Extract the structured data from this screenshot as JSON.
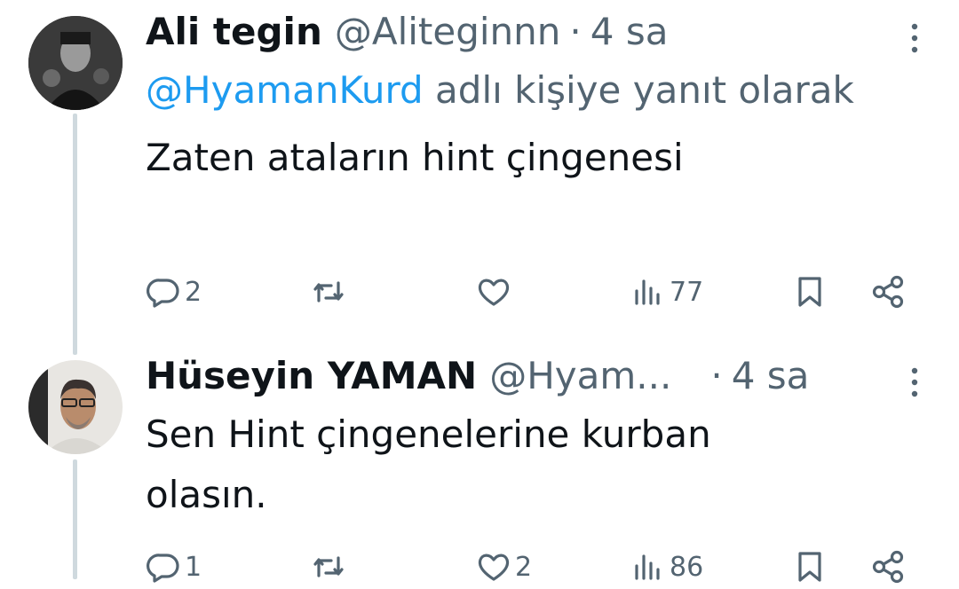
{
  "tweets": [
    {
      "display_name": "Ali tegin",
      "handle": "@Aliteginnn",
      "separator": "·",
      "time": "4 sa",
      "reply_mention": "@HyamanKurd",
      "reply_suffix": " adlı kişiye yanıt olarak",
      "text": "Zaten ataların hint çingenesi",
      "replies": "2",
      "retweets": "",
      "likes": "",
      "views": "77"
    },
    {
      "display_name": "Hüseyin YAMAN",
      "handle": "@Hyam...",
      "separator": "·",
      "time": "4 sa",
      "text": "Sen Hint çingenelerine kurban olasın.",
      "replies": "1",
      "retweets": "",
      "likes": "2",
      "views": "86"
    }
  ],
  "icons": {
    "reply": "comment-bubble-icon",
    "retweet": "retweet-icon",
    "like": "heart-icon",
    "views": "bar-chart-icon",
    "bookmark": "bookmark-icon",
    "share": "share-icon",
    "more": "vertical-dots-icon"
  },
  "colors": {
    "link": "#1d9bf0",
    "muted": "#536471",
    "text": "#0f1419",
    "thread_line": "#cfd9de"
  }
}
